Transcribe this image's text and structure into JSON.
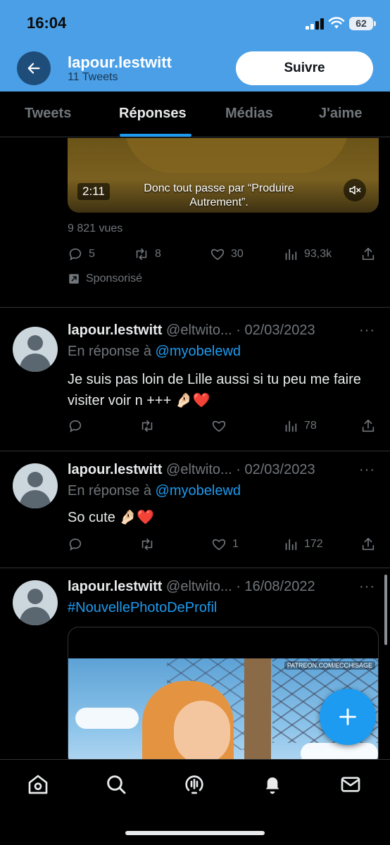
{
  "status_bar": {
    "time": "16:04",
    "battery": "62"
  },
  "header": {
    "username": "lapour.lestwitt",
    "tweet_count": "11 Tweets",
    "follow_label": "Suivre"
  },
  "tabs": [
    {
      "label": "Tweets",
      "active": false
    },
    {
      "label": "Réponses",
      "active": true
    },
    {
      "label": "Médias",
      "active": false
    },
    {
      "label": "J'aime",
      "active": false
    }
  ],
  "promoted": {
    "duration": "2:11",
    "caption": "Donc tout passe par “Produire Autrement”.",
    "views": "9 821 vues",
    "replies": "5",
    "retweets": "8",
    "likes": "30",
    "impressions": "93,3k",
    "sponsored_label": "Sponsorisé"
  },
  "tweets": [
    {
      "name": "lapour.lestwitt",
      "meta": "@eltwito... · 02/03/2023",
      "reply_prefix": "En réponse à",
      "reply_to": "@myobelewd",
      "text": "Je suis pas loin de Lille aussi si tu peu me faire visiter voir n +++ 🤌🏻❤️",
      "replies": "",
      "retweets": "",
      "likes": "",
      "views": "78"
    },
    {
      "name": "lapour.lestwitt",
      "meta": "@eltwito... · 02/03/2023",
      "reply_prefix": "En réponse à",
      "reply_to": "@myobelewd",
      "text": "So cute 🤌🏻❤️",
      "replies": "",
      "retweets": "",
      "likes": "1",
      "views": "172"
    },
    {
      "name": "lapour.lestwitt",
      "meta": "@eltwito... · 16/08/2022",
      "hashtag": "#NouvellePhotoDeProfil",
      "watermark": "PATREON.COM/ECCHISAGE"
    }
  ],
  "colors": {
    "header_blue": "#4a9fe6",
    "accent": "#1d9bf0",
    "muted": "#71767b",
    "background": "#000000"
  },
  "icons": [
    "back-arrow-icon",
    "reply-icon",
    "retweet-icon",
    "like-icon",
    "views-icon",
    "share-icon",
    "promoted-icon",
    "mute-icon",
    "more-icon",
    "compose-plus-icon",
    "home-icon",
    "search-icon",
    "spaces-icon",
    "notifications-icon",
    "messages-icon"
  ]
}
